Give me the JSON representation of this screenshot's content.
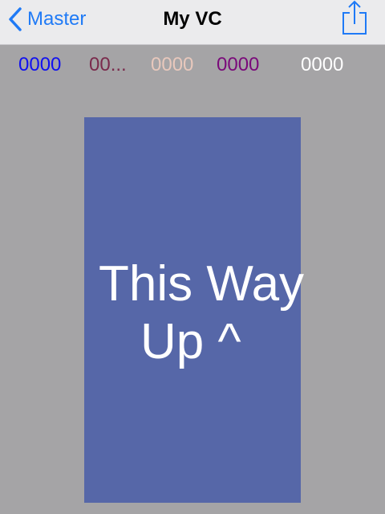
{
  "navbar": {
    "back_label": "Master",
    "title": "My VC",
    "share_icon": "share-icon",
    "back_icon": "chevron-left-icon",
    "tint_color": "#1f7af6"
  },
  "labels": [
    {
      "text": "0000",
      "color": "#1010f0"
    },
    {
      "text": "00...",
      "color": "#7a2a4c"
    },
    {
      "text": "0000",
      "color": "#e8c8bc"
    },
    {
      "text": "0000",
      "color": "#7a0a7a"
    },
    {
      "text": "0000",
      "color": "#ffffff"
    }
  ],
  "panel": {
    "line1": "This Way",
    "line2": "Up ^",
    "background": "#5667a8",
    "text_color": "#ffffff"
  },
  "background_color": "#a5a4a6"
}
